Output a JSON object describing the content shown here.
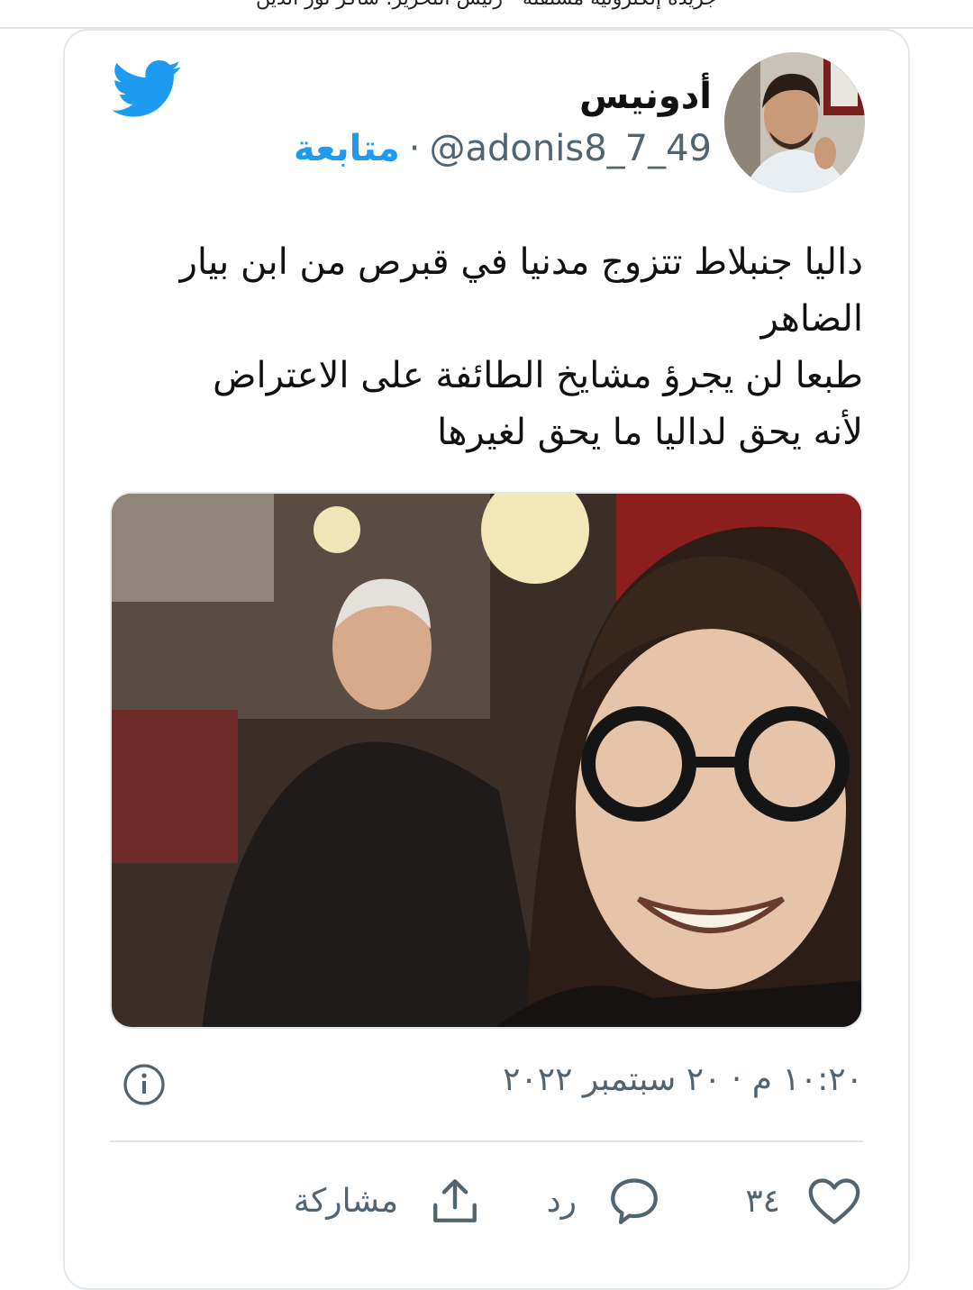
{
  "header": {
    "banner_text": "جريدة إلكترونية مستقلة - رئيس التحرير: شاكر نور الدين"
  },
  "tweet": {
    "display_name": "أدونيس",
    "handle": "@adonis8_7_49",
    "separator": "·",
    "follow_label": "متابعة",
    "text_lines": [
      "داليا جنبلاط تتزوج مدنيا في قبرص من ابن بيار",
      "الضاهر",
      "طبعا لن يجرؤ مشايخ الطائفة على الاعتراض",
      "لأنه يحق لداليا ما يحق لغيرها"
    ],
    "timestamp": "١٠:٢٠ م · ٢٠ سبتمبر ٢٠٢٢"
  },
  "actions": {
    "like_count": "٣٤",
    "reply_label": "رد",
    "share_label": "مشاركة"
  },
  "icons": {
    "brand": "twitter-bird-icon",
    "info": "info-icon",
    "like": "heart-icon",
    "reply": "speech-bubble-icon",
    "share": "share-upload-icon"
  },
  "colors": {
    "brand_blue": "#1d9bf0",
    "text_primary": "#111111",
    "text_secondary": "#536471",
    "border": "#e1e8ed"
  }
}
